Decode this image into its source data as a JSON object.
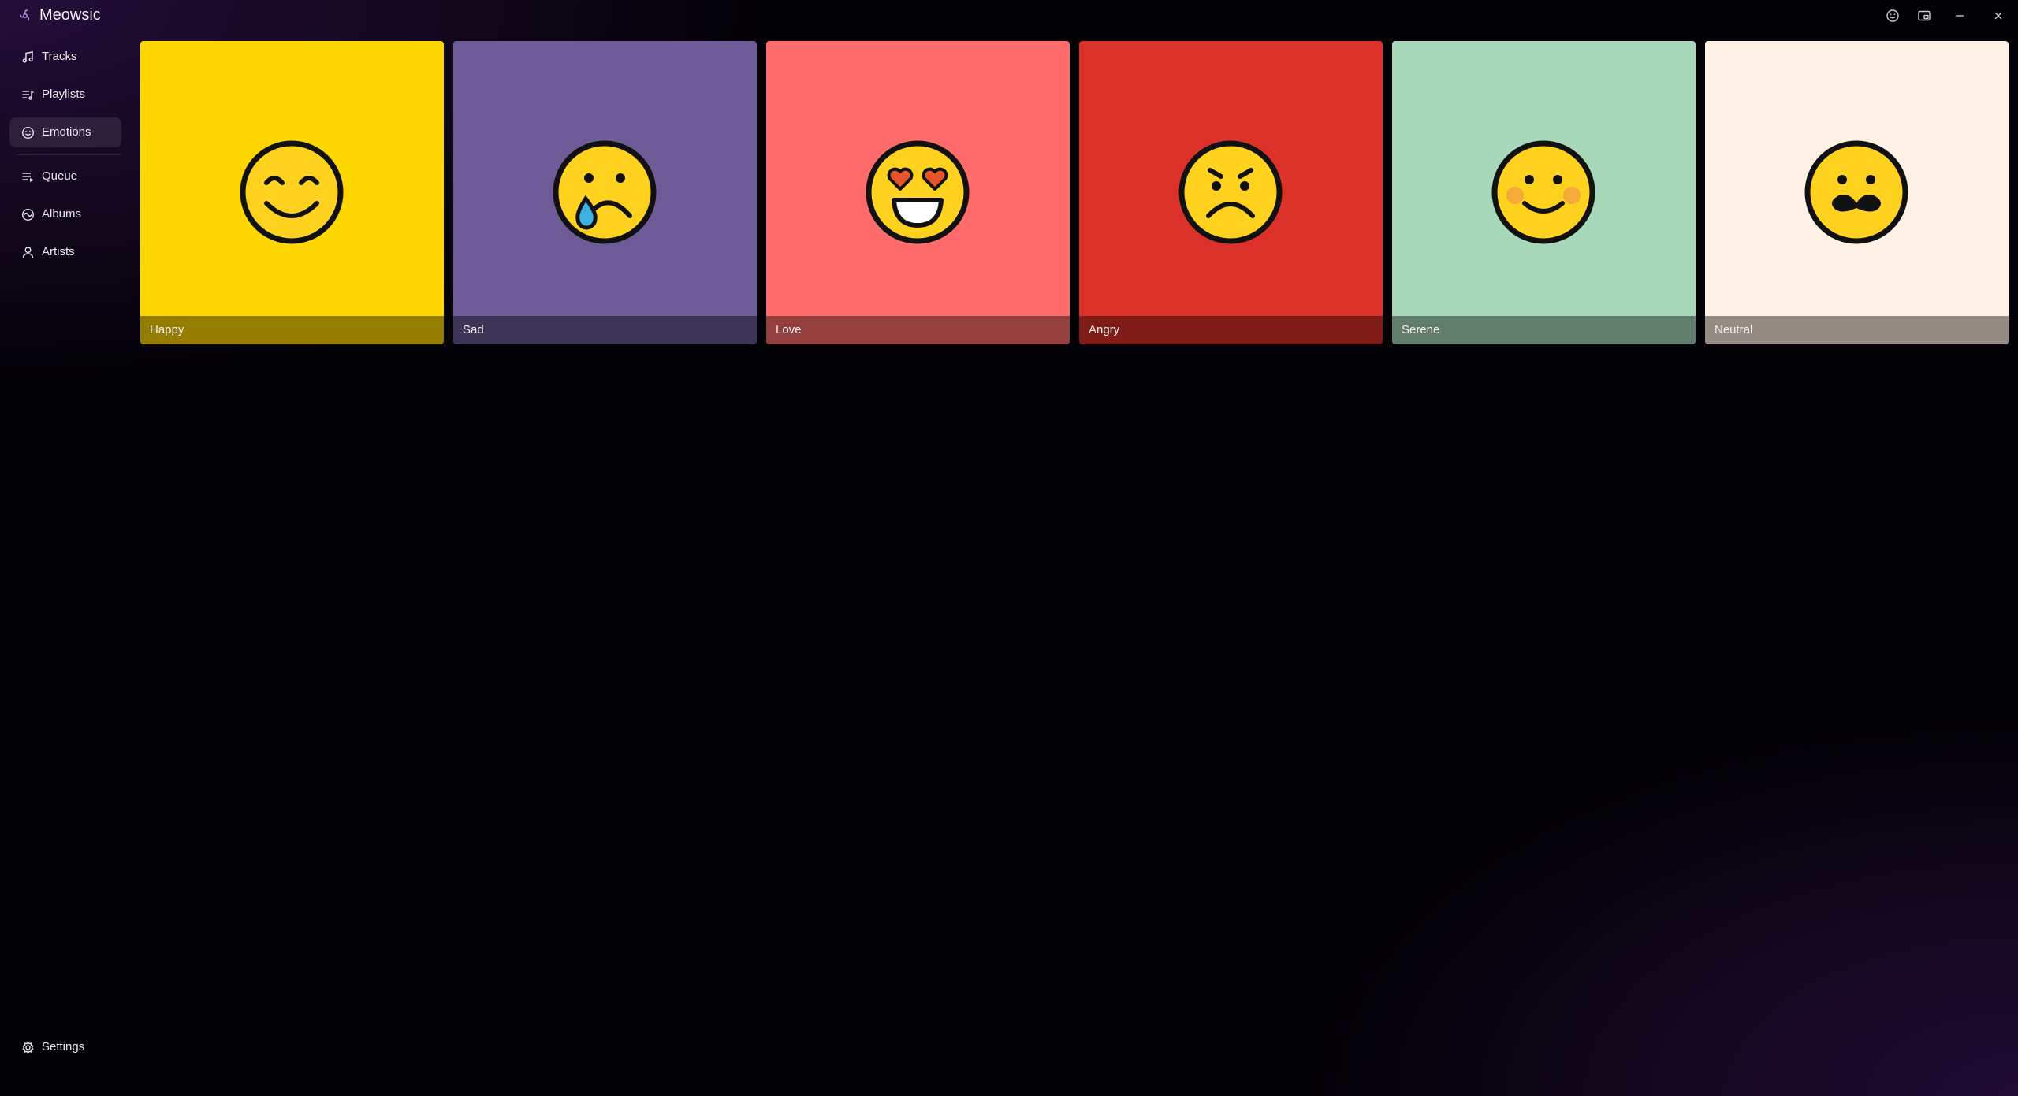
{
  "app": {
    "title": "Meowsic"
  },
  "window_controls": [
    {
      "name": "emotion-icon-button"
    },
    {
      "name": "miniplayer-button"
    },
    {
      "name": "minimize-button"
    },
    {
      "name": "close-button"
    }
  ],
  "sidebar": {
    "items": [
      {
        "label": "Tracks",
        "icon": "music-note-icon"
      },
      {
        "label": "Playlists",
        "icon": "playlist-icon"
      },
      {
        "label": "Emotions",
        "icon": "smiley-icon",
        "active": true
      },
      {
        "label": "Queue",
        "icon": "queue-icon"
      },
      {
        "label": "Albums",
        "icon": "album-icon"
      },
      {
        "label": "Artists",
        "icon": "person-icon"
      }
    ],
    "settings": {
      "label": "Settings",
      "icon": "gear-icon"
    }
  },
  "emotions": [
    {
      "label": "Happy",
      "color": "#FFD700",
      "icon": "smiling-eyes-emoji"
    },
    {
      "label": "Sad",
      "color": "#6C5B97",
      "icon": "crying-emoji"
    },
    {
      "label": "Love",
      "color": "#FF6B6B",
      "icon": "heart-eyes-emoji"
    },
    {
      "label": "Angry",
      "color": "#DC3129",
      "icon": "frowning-angry-emoji"
    },
    {
      "label": "Serene",
      "color": "#A8D8BA",
      "icon": "blushing-smile-emoji"
    },
    {
      "label": "Neutral",
      "color": "#FFF1E6",
      "icon": "mustache-emoji"
    }
  ]
}
